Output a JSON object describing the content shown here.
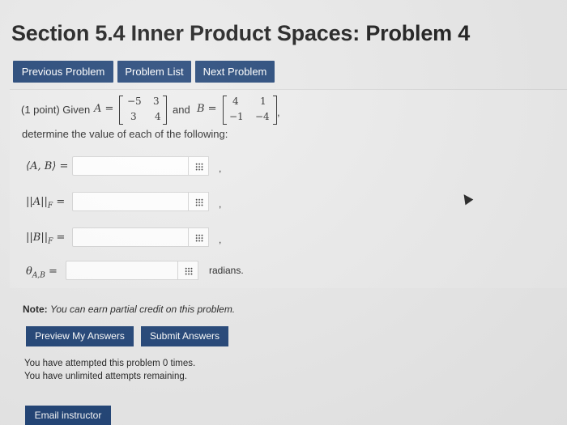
{
  "header": {
    "title": "Section 5.4 Inner Product Spaces: Problem 4"
  },
  "nav": {
    "previous": "Previous Problem",
    "list": "Problem List",
    "next": "Next Problem"
  },
  "problem": {
    "points": "(1 point) Given",
    "A_label": "A =",
    "and_label": "and",
    "B_label": "B =",
    "A": [
      [
        "−5",
        "3"
      ],
      [
        "3",
        "4"
      ]
    ],
    "B": [
      [
        "4",
        "1"
      ],
      [
        "−1",
        "−4"
      ]
    ],
    "end_comma": ",",
    "instruction": "determine the value of each of the following:",
    "questions": [
      {
        "label": "⟨A, B⟩ =",
        "suffix": ","
      },
      {
        "label": "||A||",
        "sub": "F",
        "eq": "=",
        "suffix": ","
      },
      {
        "label": "||B||",
        "sub": "F",
        "eq": "=",
        "suffix": ","
      },
      {
        "label": "θ",
        "sub": "A,B",
        "eq": "=",
        "suffix": "radians."
      }
    ]
  },
  "note": {
    "bold": "Note:",
    "text": "You can earn partial credit on this problem."
  },
  "actions": {
    "preview": "Preview My Answers",
    "submit": "Submit Answers"
  },
  "attempts": {
    "line1": "You have attempted this problem 0 times.",
    "line2": "You have unlimited attempts remaining."
  },
  "email": "Email instructor",
  "icons": {
    "grid": "matrix-grid-icon",
    "cursor": "mouse-cursor-icon"
  }
}
